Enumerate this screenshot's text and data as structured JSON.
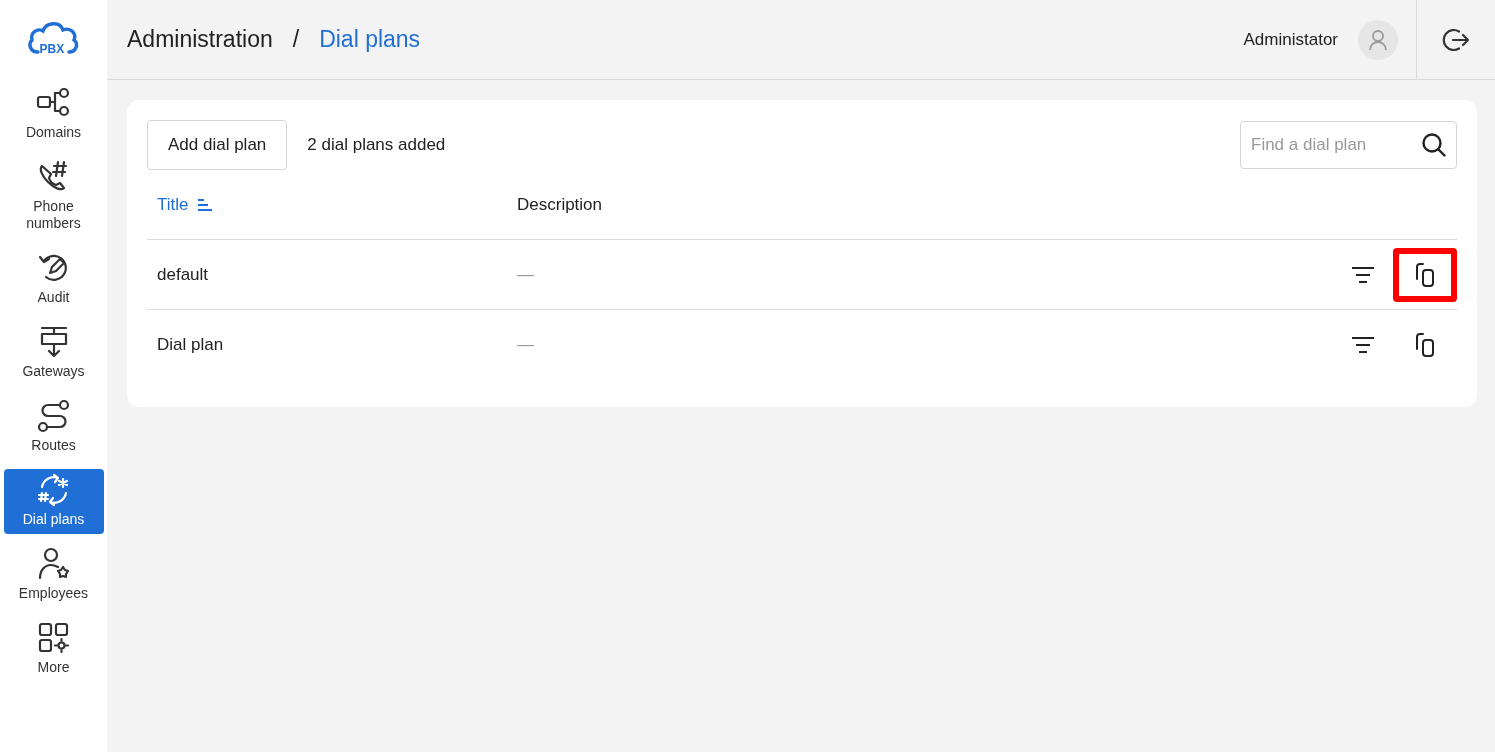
{
  "logo": {
    "text": "PBX"
  },
  "nav": [
    {
      "kind": "domains",
      "label": "Domains",
      "selected": false
    },
    {
      "kind": "phone",
      "label": "Phone numbers",
      "selected": false
    },
    {
      "kind": "audit",
      "label": "Audit",
      "selected": false
    },
    {
      "kind": "gateways",
      "label": "Gateways",
      "selected": false
    },
    {
      "kind": "routes",
      "label": "Routes",
      "selected": false
    },
    {
      "kind": "dialplans",
      "label": "Dial plans",
      "selected": true
    },
    {
      "kind": "employees",
      "label": "Employees",
      "selected": false
    },
    {
      "kind": "more",
      "label": "More",
      "selected": false
    }
  ],
  "breadcrumb": {
    "parent": "Administration",
    "separator": "/",
    "current": "Dial plans"
  },
  "user": {
    "name": "Administator"
  },
  "toolbar": {
    "add_button": "Add dial plan",
    "count": "2 dial plans added",
    "search": {
      "placeholder": "Find a dial plan"
    }
  },
  "table": {
    "columns": [
      {
        "label": "Title",
        "sorted": true
      },
      {
        "label": "Description",
        "sorted": false
      }
    ],
    "rows": [
      {
        "title": "default",
        "description": "—",
        "copy_highlighted": true
      },
      {
        "title": "Dial plan",
        "description": "—",
        "copy_highlighted": false
      }
    ]
  }
}
